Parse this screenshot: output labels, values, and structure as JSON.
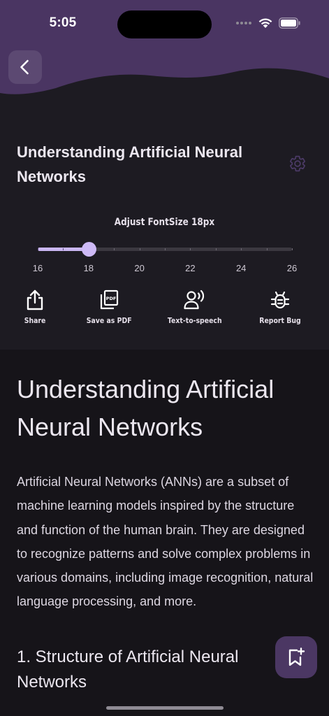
{
  "status_bar": {
    "time": "5:05"
  },
  "header": {
    "back_icon": "chevron-left-icon",
    "wave_color": "#4a3562"
  },
  "settings_panel": {
    "title": "Understanding Artificial Neural Networks",
    "settings_icon": "gear-icon",
    "font_size": {
      "label": "Adjust FontSize 18px",
      "min": 16,
      "max": 26,
      "value": 18,
      "tick_labels": [
        "16",
        "18",
        "20",
        "22",
        "24",
        "26"
      ]
    },
    "actions": [
      {
        "label": "Share",
        "icon": "share-icon"
      },
      {
        "label": "Save as PDF",
        "icon": "pdf-icon"
      },
      {
        "label": "Text-to-speech",
        "icon": "text-to-speech-icon"
      },
      {
        "label": "Report Bug",
        "icon": "bug-icon"
      }
    ]
  },
  "article": {
    "heading": "Understanding Artificial Neural Networks",
    "intro": "Artificial Neural Networks (ANNs) are a subset of machine learning models inspired by the structure and function of the human brain. They are designed to recognize patterns and solve complex problems in various domains, including image recognition, natural language processing, and more.",
    "section_heading": "1. Structure of Artificial Neural Networks"
  },
  "fab": {
    "icon": "bookmark-add-icon"
  },
  "colors": {
    "background": "#161419",
    "panel": "#1d1b22",
    "accent": "#c9b6f2",
    "fab": "#4b3763"
  }
}
